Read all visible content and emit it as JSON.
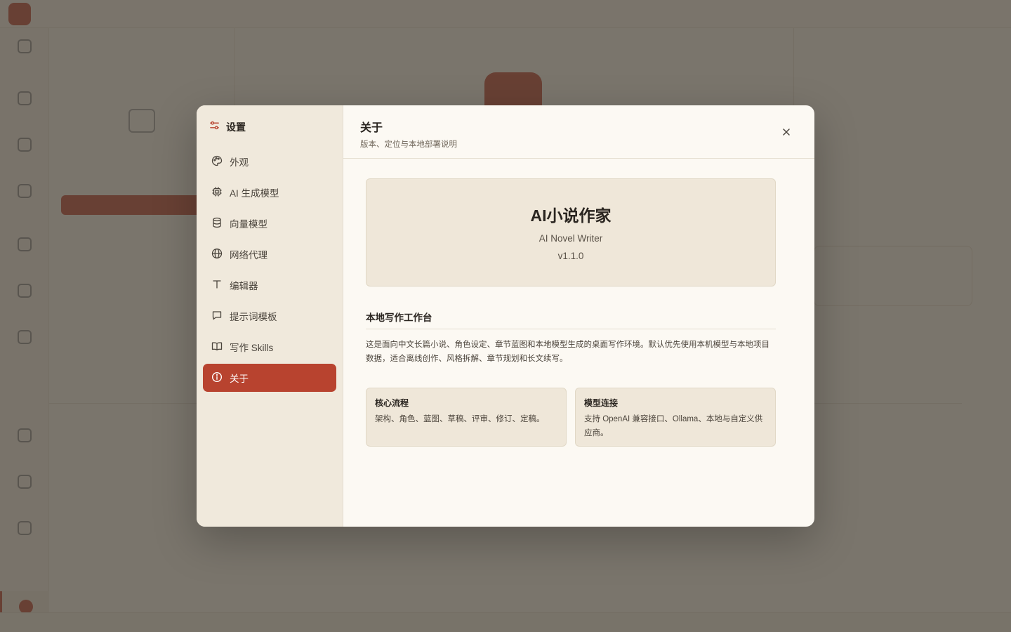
{
  "settings": {
    "title": "设置",
    "nav": [
      {
        "label": "外观",
        "icon": "palette-icon"
      },
      {
        "label": "AI 生成模型",
        "icon": "chip-icon"
      },
      {
        "label": "向量模型",
        "icon": "database-icon"
      },
      {
        "label": "网络代理",
        "icon": "globe-icon"
      },
      {
        "label": "编辑器",
        "icon": "text-icon"
      },
      {
        "label": "提示词模板",
        "icon": "chat-icon"
      },
      {
        "label": "写作 Skills",
        "icon": "book-icon"
      },
      {
        "label": "关于",
        "icon": "info-icon",
        "active": true
      }
    ]
  },
  "about": {
    "title": "关于",
    "subtitle": "版本、定位与本地部署说明",
    "app_name": "AI小说作家",
    "app_name_en": "AI Novel Writer",
    "version": "v1.1.0",
    "section_title": "本地写作工作台",
    "section_desc": "这是面向中文长篇小说、角色设定、章节蓝图和本地模型生成的桌面写作环境。默认优先使用本机模型与本地项目数据，适合离线创作、风格拆解、章节规划和长文续写。",
    "cards": [
      {
        "title": "核心流程",
        "text": "架构、角色、蓝图、草稿、评审、修订、定稿。"
      },
      {
        "title": "模型连接",
        "text": "支持 OpenAI 兼容接口、Ollama、本地与自定义供应商。"
      }
    ]
  },
  "colors": {
    "accent": "#b8432f",
    "sidebar_bg": "#f0e9dc",
    "content_bg": "#fcf9f3",
    "card_bg": "#efe7d9"
  }
}
